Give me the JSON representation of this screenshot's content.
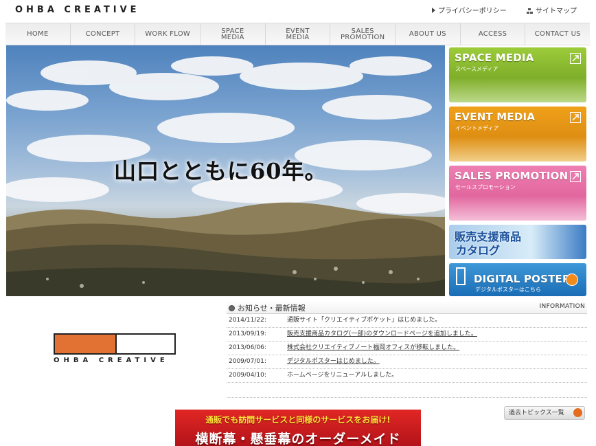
{
  "header": {
    "brand": "OHBA CREATIVE",
    "privacy_label": "プライバシーポリシー",
    "sitemap_label": "サイトマップ"
  },
  "nav": {
    "items": [
      {
        "label": "HOME"
      },
      {
        "label": "CONCEPT"
      },
      {
        "label": "WORK FLOW"
      },
      {
        "label": "SPACE\nMEDIA"
      },
      {
        "label": "EVENT\nMEDIA"
      },
      {
        "label": "SALES\nPROMOTION"
      },
      {
        "label": "ABOUT US"
      },
      {
        "label": "ACCESS"
      },
      {
        "label": "CONTACT US"
      }
    ]
  },
  "hero": {
    "headline": "山口とともに60年。"
  },
  "side_banners": {
    "space_media": {
      "title": "SPACE MEDIA",
      "subtitle": "スペースメディア",
      "color": "#8dbe2f"
    },
    "event_media": {
      "title": "EVENT MEDIA",
      "subtitle": "イベントメディア",
      "color": "#e8971a"
    },
    "sales_promotion": {
      "title": "SALES PROMOTION",
      "subtitle": "セールスプロモーション",
      "color": "#e772a8"
    },
    "catalog": {
      "line1": "販売支援商品",
      "line2": "カタログ"
    },
    "digital_poster": {
      "title": "DIGITAL POSTER",
      "subtitle": "デジタルポスターはこちら"
    }
  },
  "logo": {
    "word": "OHBA CREATIVE",
    "accent_color": "#e27234"
  },
  "news": {
    "title": "お知らせ・最新情報",
    "section_label": "INFORMATION",
    "items": [
      {
        "date": "2014/11/22:",
        "text": "通販サイト「クリエイティブポケット」はじめました。"
      },
      {
        "date": "2013/09/19:",
        "text": "販売支援商品カタログ(一部)のダウンロードページを追加しました。"
      },
      {
        "date": "2013/06/06:",
        "text": "株式会社クリエイティブノート福岡オフィスが移転しました。"
      },
      {
        "date": "2009/07/01:",
        "text": "デジタルポスターはじめました。"
      },
      {
        "date": "2009/04/10:",
        "text": "ホームページをリニューアルしました。"
      }
    ],
    "past_label": "過去トピックス一覧"
  },
  "bottom_banner": {
    "line1": "通販でも訪問サービスと同様のサービスをお届け!",
    "line2": "横断幕・懸垂幕のオーダーメイド"
  }
}
